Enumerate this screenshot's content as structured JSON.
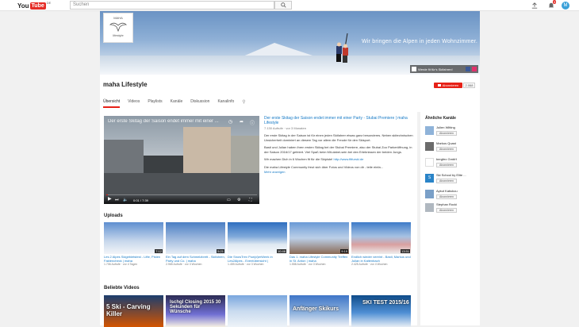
{
  "topbar": {
    "logo_you": "You",
    "logo_tube": "Tube",
    "logo_region": "DE",
    "search_placeholder": "Suchen",
    "notification_count": "3",
    "avatar_letter": "M"
  },
  "banner": {
    "slogan": "Wir bringen die Alpen in jeden Wohnzimmer.",
    "logo_line1": "MAHA",
    "logo_line2": "lifestyle",
    "link_label": "Werde fit für's Skifahren!"
  },
  "channel": {
    "name": "maha Lifestyle",
    "subscribe_label": "Abonnieren",
    "subscriber_count": "2.068",
    "tabs": [
      "Übersicht",
      "Videos",
      "Playlists",
      "Kanäle",
      "Diskussion",
      "Kanalinfo"
    ],
    "active_tab": 0
  },
  "featured": {
    "player_title": "Der erste Skitag der Saison endet immer mit einer ...",
    "time": "0:01 / 7:39",
    "progress": 0.01,
    "title": "Der erste Skitag der Saison endet immer mit einer Party - Stubai Premiere | maha Lifestyle",
    "meta": "7.130 Aufrufe · vor 3 Monaten",
    "desc1": "Der erste Skitag in der Saison ist für einen jeden Skifahrer etwas ganz besonderes. Neben skitechnischen Unsicherheit dominiert an diesem Tag vor allem die Freude für den Skisport.",
    "desc2": "Basti und Julian haben ihren ersten Skitag bei der Stubai Premiere, also der Stubai Zoo Parkeröffnung, in der Saison 2016/17 gefeiert. Viel Spaß beim Mit-dabei-sein bei den Erlebnissen der beiden Jungs.",
    "desc3_prefix": "Wir machen Dich in 6 Wochen fit für die Skipiste!",
    "desc3_link": "http://www.fitfurski.de",
    "desc4": "Die maha Lifestyle Community freut sich über Fotos und Videos von dir - teile einfa...",
    "more_label": "Mehr anzeigen"
  },
  "uploads": {
    "title": "Uploads",
    "items": [
      {
        "title": "Les 2 Alpes Skigebietstest - Lifte, Pisten Faktencheck | maha",
        "meta": "1.706 Aufrufe · vor 4 Tagen",
        "duration": "7:12"
      },
      {
        "title": "Ein Tag auf dem Schmelzbrett - Skifahren, Party und Co. | maha",
        "meta": "2.965 Aufrufe · vor 3 Wochen",
        "duration": "5:21"
      },
      {
        "title": "Die SnowTrex Pow(d)erWeek in Les2Alpes - Eventübersicht |",
        "meta": "1.459 Aufrufe · vor 3 Wochen",
        "duration": "10:46"
      },
      {
        "title": "Das 1. maha Lifestyle Community Treffen in St. Anton | maha",
        "meta": "1.558 Aufrufe · vor 3 Wochen",
        "duration": "9:19"
      },
      {
        "title": "Endlich wieder vereint - Basti, Markus und Julian in Kaltenbach",
        "meta": "2.425 Aufrufe · vor 4 Wochen",
        "duration": "13:51"
      }
    ]
  },
  "popular": {
    "title": "Beliebte Videos",
    "overlays": [
      "5 Ski - Carving Killer",
      "Ischgl Closing 2015 30 Sekunden für Wünsche",
      "",
      "Anfänger Skikurs",
      "SKI TEST 2015/16"
    ]
  },
  "sidebar": {
    "title": "Ähnliche Kanäle",
    "subscribe_label": "Abonnieren",
    "channels": [
      {
        "name": "Julien Witting"
      },
      {
        "name": "Markus Quast"
      },
      {
        "name": "bergfex GmbH"
      },
      {
        "name": "Ski School by Elite ..."
      },
      {
        "name": "Aykut Kabukcu"
      },
      {
        "name": "Stephan Rocki"
      }
    ]
  }
}
